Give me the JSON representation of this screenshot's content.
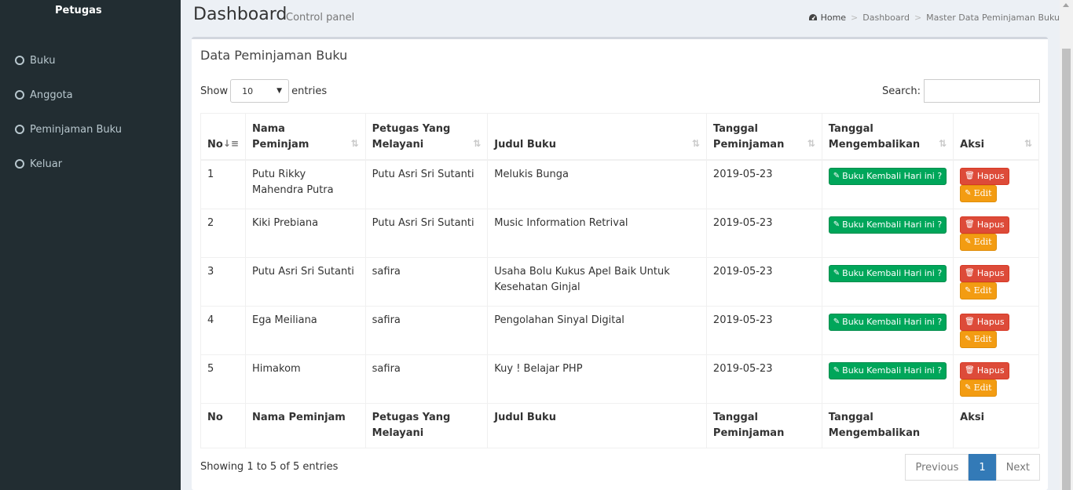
{
  "sidebar": {
    "user": "Petugas",
    "items": [
      {
        "label": "Buku"
      },
      {
        "label": "Anggota"
      },
      {
        "label": "Peminjaman Buku"
      },
      {
        "label": "Keluar"
      }
    ]
  },
  "header": {
    "title": "Dashboard",
    "subtitle": "Control panel"
  },
  "breadcrumb": {
    "home": "Home",
    "items": [
      "Dashboard",
      "Master Data Peminjaman Buku"
    ]
  },
  "box": {
    "title": "Data Peminjaman Buku"
  },
  "controls": {
    "show_label": "Show",
    "entries_value": "10",
    "entries_label": "entries",
    "search_label": "Search:",
    "search_value": ""
  },
  "table": {
    "headers": [
      "No",
      "Nama Peminjam",
      "Petugas Yang Melayani",
      "Judul Buku",
      "Tanggal Peminjaman",
      "Tanggal Mengembalikan",
      "Aksi"
    ],
    "rows": [
      {
        "no": "1",
        "nama": "Putu Rikky Mahendra Putra",
        "petugas": "Putu Asri Sri Sutanti",
        "judul": "Melukis Bunga",
        "tanggal": "2019-05-23"
      },
      {
        "no": "2",
        "nama": "Kiki Prebiana",
        "petugas": "Putu Asri Sri Sutanti",
        "judul": "Music Information Retrival",
        "tanggal": "2019-05-23"
      },
      {
        "no": "3",
        "nama": "Putu Asri Sri Sutanti",
        "petugas": "safira",
        "judul": "Usaha Bolu Kukus Apel Baik Untuk Kesehatan Ginjal",
        "tanggal": "2019-05-23"
      },
      {
        "no": "4",
        "nama": "Ega Meiliana",
        "petugas": "safira",
        "judul": "Pengolahan Sinyal Digital",
        "tanggal": "2019-05-23"
      },
      {
        "no": "5",
        "nama": "Himakom",
        "petugas": "safira",
        "judul": "Kuy ! Belajar PHP",
        "tanggal": "2019-05-23"
      }
    ],
    "btn_kembali": "Buku Kembali Hari ini ?",
    "btn_hapus": "Hapus",
    "btn_edit": "Edit"
  },
  "footer": {
    "info": "Showing 1 to 5 of 5 entries",
    "prev": "Previous",
    "page": "1",
    "next": "Next"
  },
  "colors": {
    "sidebar": "#222d32",
    "success": "#00a65a",
    "danger": "#dd4b39",
    "warning": "#f39c12",
    "primary": "#337ab7"
  }
}
